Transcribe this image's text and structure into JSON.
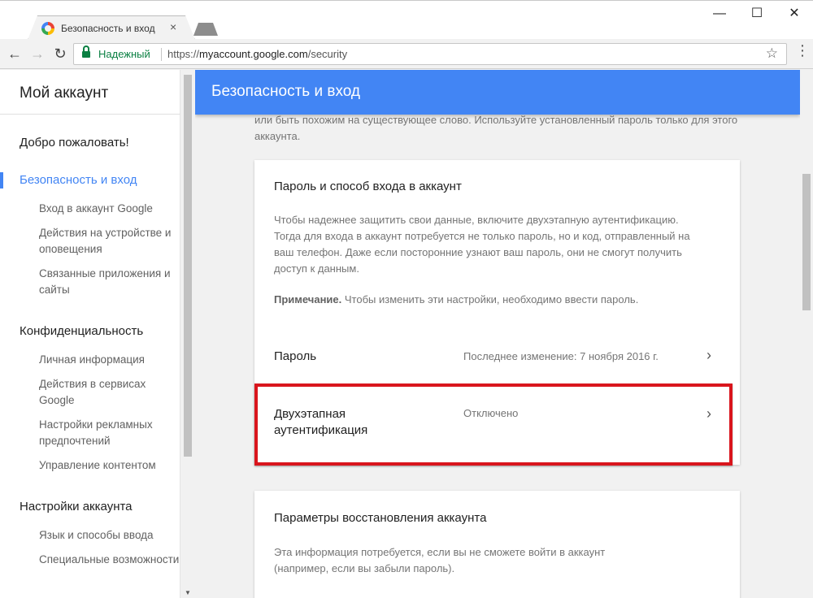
{
  "browser": {
    "tab_title": "Безопасность и вход",
    "tab_close": "×",
    "window": {
      "minimize": "—",
      "maximize": "☐",
      "close": "✕"
    },
    "secure_label": "Надежный",
    "url_scheme": "https://",
    "url_host": "myaccount.google.com",
    "url_path": "/security",
    "nav": {
      "back": "←",
      "forward": "→",
      "reload": "↻"
    },
    "star": "☆",
    "menu": "⋮"
  },
  "sidebar": {
    "title": "Мой аккаунт",
    "welcome": "Добро пожаловать!",
    "sections": [
      {
        "label": "Безопасность и вход",
        "items": [
          "Вход в аккаунт Google",
          "Действия на устройстве и оповещения",
          "Связанные приложения и сайты"
        ]
      },
      {
        "label": "Конфиденциальность",
        "items": [
          "Личная информация",
          "Действия в сервисах Google",
          "Настройки рекламных предпочтений",
          "Управление контентом"
        ]
      },
      {
        "label": "Настройки аккаунта",
        "items": [
          "Язык и способы ввода",
          "Специальные возможности"
        ]
      }
    ]
  },
  "main": {
    "header": "Безопасность и вход",
    "top_note": "или быть похожим на существующее слово. Используйте установленный пароль только для этого аккаунта.",
    "password_card": {
      "title": "Пароль и способ входа в аккаунт",
      "description": "Чтобы надежнее защитить свои данные, включите двухэтапную аутентификацию. Тогда для входа в аккаунт потребуется не только пароль, но и код, отправленный на ваш телефон. Даже если посторонние узнают ваш пароль, они не смогут получить доступ к данным.",
      "note_bold": "Примечание.",
      "note_text": " Чтобы изменить эти настройки, необходимо ввести пароль.",
      "rows": [
        {
          "label": "Пароль",
          "value": "Последнее изменение: 7 ноября 2016 г.",
          "chevron": "›"
        },
        {
          "label": "Двухэтапная аутентификация",
          "value": "Отключено",
          "chevron": "›"
        }
      ]
    },
    "recovery_card": {
      "title": "Параметры восстановления аккаунта",
      "description": "Эта информация потребуется, если вы не сможете войти в аккаунт (например, если вы забыли пароль)."
    }
  },
  "colors": {
    "accent": "#4285f4",
    "highlight": "#d9151d",
    "secure": "#0b8043"
  }
}
